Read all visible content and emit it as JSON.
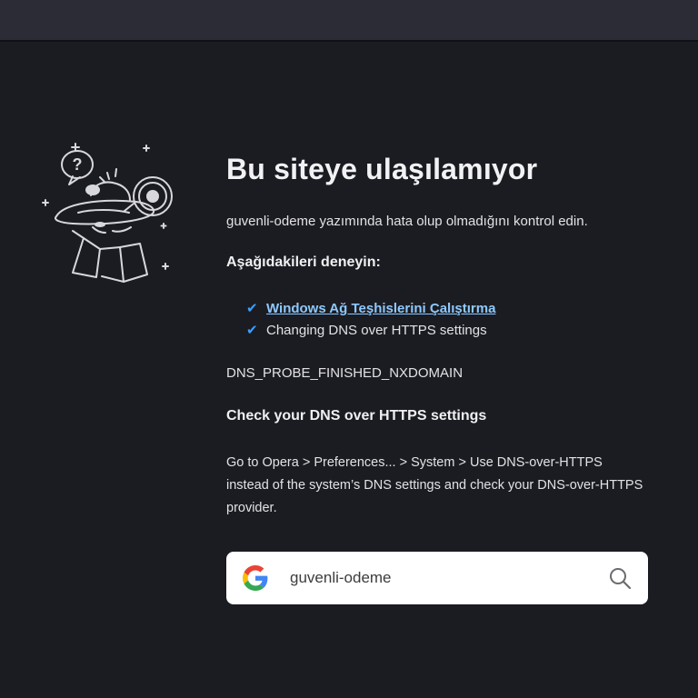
{
  "page": {
    "title": "Bu siteye ulaşılamıyor",
    "subtitle": "guvenli-odeme yazımında hata olup olmadığını kontrol edin.",
    "try_heading": "Aşağıdakileri deneyin:",
    "suggestions": [
      {
        "label": "Windows Ağ Teşhislerini Çalıştırma",
        "is_link": true
      },
      {
        "label": "Changing DNS over HTTPS settings",
        "is_link": false
      }
    ],
    "error_code": "DNS_PROBE_FINISHED_NXDOMAIN",
    "dns_heading": "Check your DNS over HTTPS settings",
    "dns_body": "Go to Opera > Preferences... > System > Use DNS-over-HTTPS instead of the system’s DNS settings and check your DNS-over-HTTPS provider."
  },
  "search": {
    "value": "guvenli-odeme",
    "engine_icon": "google-g-icon",
    "action_icon": "search-icon"
  },
  "colors": {
    "background": "#1b1c21",
    "topbar": "#2b2c35",
    "link": "#8ec9ff",
    "check": "#3aa0ff"
  }
}
